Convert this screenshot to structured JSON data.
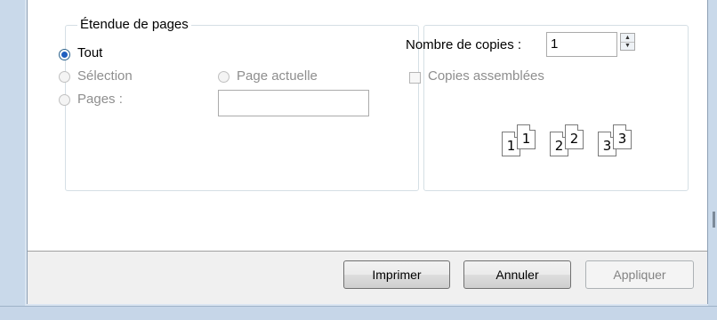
{
  "page_range": {
    "legend": "Étendue de pages",
    "options": {
      "all": "Tout",
      "selection": "Sélection",
      "current_page": "Page actuelle",
      "pages": "Pages :"
    },
    "pages_value": ""
  },
  "copies": {
    "label": "Nombre de copies :",
    "value": "1",
    "collate_label": "Copies assemblées",
    "collate_pages": [
      "1",
      "1",
      "2",
      "2",
      "3",
      "3"
    ]
  },
  "buttons": {
    "print": "Imprimer",
    "cancel": "Annuler",
    "apply": "Appliquer"
  }
}
